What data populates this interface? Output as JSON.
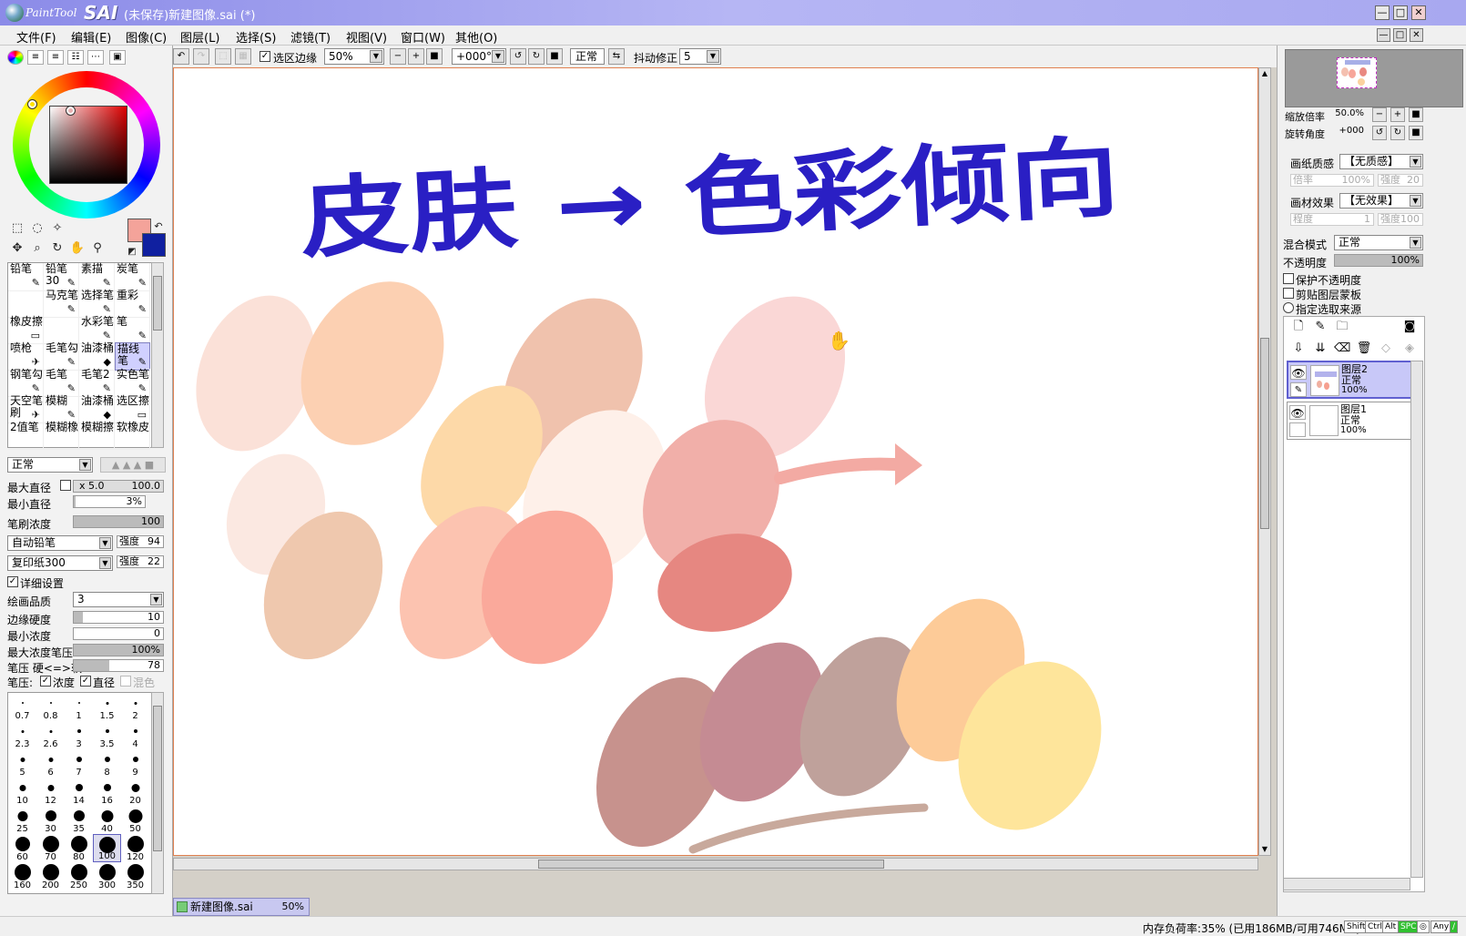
{
  "window": {
    "app_name_left": "PaintTool",
    "app_name_right": "SAI",
    "title": "(未保存)新建图像.sai (*)",
    "controls": [
      "—",
      "□",
      "✕"
    ]
  },
  "menu": {
    "items": [
      "文件(F)",
      "编辑(E)",
      "图像(C)",
      "图层(L)",
      "选择(S)",
      "滤镜(T)",
      "视图(V)",
      "窗口(W)",
      "其他(O)"
    ],
    "mdi_controls": [
      "—",
      "□",
      "✕"
    ]
  },
  "toolbar": {
    "selection_edge_label": "选区边缘",
    "zoom_value": "50%",
    "rotation_value": "+000°",
    "blend_button": "正常",
    "stabilizer_label": "抖动修正",
    "stabilizer_value": "5"
  },
  "brushes": {
    "cells": [
      {
        "label": "铅笔",
        "icon": "✎"
      },
      {
        "label": "铅笔30",
        "icon": "✎"
      },
      {
        "label": "素描",
        "icon": "✎"
      },
      {
        "label": "炭笔",
        "icon": "✎"
      },
      {
        "label": "",
        "icon": ""
      },
      {
        "label": "马克笔",
        "icon": "✎"
      },
      {
        "label": "选择笔",
        "icon": "✎"
      },
      {
        "label": "重彩",
        "icon": "✎"
      },
      {
        "label": "橡皮擦",
        "icon": "▭"
      },
      {
        "label": "",
        "icon": ""
      },
      {
        "label": "水彩笔",
        "icon": "✎"
      },
      {
        "label": "笔",
        "icon": "✎"
      },
      {
        "label": "喷枪",
        "icon": "✈"
      },
      {
        "label": "毛笔勾",
        "icon": "✎"
      },
      {
        "label": "油漆桶",
        "icon": "◆"
      },
      {
        "label": "描线笔",
        "icon": "✎"
      },
      {
        "label": "钢笔勾",
        "icon": "✎"
      },
      {
        "label": "毛笔",
        "icon": "✎"
      },
      {
        "label": "毛笔2",
        "icon": "✎"
      },
      {
        "label": "实色笔",
        "icon": "✎"
      },
      {
        "label": "天空笔刷",
        "icon": "✈"
      },
      {
        "label": "模糊",
        "icon": "✎"
      },
      {
        "label": "油漆桶",
        "icon": "◆"
      },
      {
        "label": "选区擦",
        "icon": "▭"
      },
      {
        "label": "2值笔",
        "icon": ""
      },
      {
        "label": "模糊橡",
        "icon": ""
      },
      {
        "label": "模糊擦",
        "icon": ""
      },
      {
        "label": "软橡皮",
        "icon": ""
      }
    ],
    "selected_index": 15
  },
  "brush_props": {
    "blend_mode": "正常",
    "max_size_label": "最大直径",
    "max_size_mult": "x 5.0",
    "max_size_value": "100.0",
    "min_size_label": "最小直径",
    "min_size_value": "3%",
    "density_label": "笔刷浓度",
    "density_value": "100",
    "shape_type": "自动铅笔",
    "shape_strength_label": "强度",
    "shape_strength": "94",
    "texture": "复印纸300",
    "texture_strength_label": "强度",
    "texture_strength": "22",
    "advanced_label": "详细设置",
    "quality_label": "绘画品质",
    "quality_value": "3",
    "edge_hardness_label": "边缘硬度",
    "edge_hardness_value": "10",
    "min_density_label": "最小浓度",
    "min_density_value": "0",
    "max_density_pressure_label": "最大浓度笔压",
    "max_density_pressure_value": "100%",
    "pressure_label": "笔压 硬<=>软",
    "pressure_value": "78",
    "pressure_opts_label": "笔压:",
    "pressure_density": "浓度",
    "pressure_size": "直径",
    "pressure_blend": "混色"
  },
  "brush_sizes": [
    "0.7",
    "0.8",
    "1",
    "1.5",
    "2",
    "2.3",
    "2.6",
    "3",
    "3.5",
    "4",
    "5",
    "6",
    "7",
    "8",
    "9",
    "10",
    "12",
    "14",
    "16",
    "20",
    "25",
    "30",
    "35",
    "40",
    "50",
    "60",
    "70",
    "80",
    "100",
    "120",
    "160",
    "200",
    "250",
    "300",
    "350"
  ],
  "brush_size_selected": "100",
  "canvas": {
    "handwritten_text": "皮肤 → 色彩倾向",
    "swatch_colors": [
      "#fbe1d8",
      "#fcd0b2",
      "#f0c2ad",
      "#fdd9a8",
      "#fef0e9",
      "#fad7d6",
      "#fbe8e1",
      "#efc8ae",
      "#fcc3b0",
      "#faa99b",
      "#f1afa9",
      "#e68781",
      "#c7928d",
      "#c58b93",
      "#bfa19b",
      "#fdcb98",
      "#fee59b"
    ],
    "ink_color": "#2a1fc4"
  },
  "doc_tab": {
    "name": "新建图像.sai",
    "zoom": "50%"
  },
  "navigator": {
    "zoom_label": "缩放倍率",
    "zoom_value": "50.0%",
    "angle_label": "旋转角度",
    "angle_value": "+000"
  },
  "layer_panel": {
    "paper_texture_label": "画纸质感",
    "paper_texture_value": "【无质感】",
    "paper_scale_label": "倍率",
    "paper_scale_value": "100%",
    "paper_strength_label": "强度",
    "paper_strength_value": "20",
    "effect_label": "画材效果",
    "effect_value": "【无效果】",
    "effect_degree_label": "程度",
    "effect_degree_value": "1",
    "effect_strength_label": "强度",
    "effect_strength_value": "100",
    "blend_label": "混合模式",
    "blend_value": "正常",
    "opacity_label": "不透明度",
    "opacity_value": "100%",
    "preserve_opacity": "保护不透明度",
    "clipping": "剪贴图层蒙板",
    "selection_source": "指定选取来源",
    "layers": [
      {
        "name": "图层2",
        "mode": "正常",
        "opacity": "100%",
        "selected": true
      },
      {
        "name": "图层1",
        "mode": "正常",
        "opacity": "100%",
        "selected": false
      }
    ]
  },
  "status": {
    "memory": "内存负荷率:35% (已用186MB/可用746MB)",
    "keys": [
      "Shift",
      "Ctrl",
      "Alt",
      "SPC",
      "◎",
      "Any",
      "∕"
    ]
  }
}
